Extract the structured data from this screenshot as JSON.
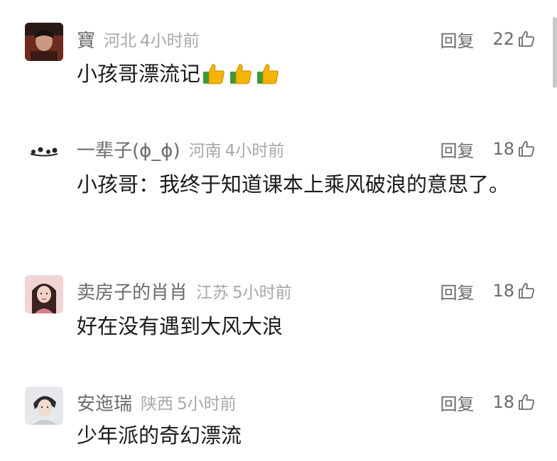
{
  "comments": [
    {
      "username": "寶",
      "location": "河北",
      "time": "4小时前",
      "reply_label": "回复",
      "likes": "22",
      "text": "小孩哥漂流记",
      "emoji": "thumbs-up",
      "emoji_count": 3
    },
    {
      "username": "一辈子(ɸ_ɸ)",
      "location": "河南",
      "time": "4小时前",
      "reply_label": "回复",
      "likes": "18",
      "text": "小孩哥：我终于知道课本上乘风破浪的意思了。"
    },
    {
      "username": "卖房子的肖肖",
      "location": "江苏",
      "time": "5小时前",
      "reply_label": "回复",
      "likes": "18",
      "text": "好在没有遇到大风大浪"
    },
    {
      "username": "安迤瑞",
      "location": "陕西",
      "time": "5小时前",
      "reply_label": "回复",
      "likes": "18",
      "text": "少年派的奇幻漂流"
    }
  ],
  "icons": {
    "like": "thumbs-up-outline-icon",
    "emoji": "thumbs-up-emoji-icon"
  },
  "colors": {
    "username": "#6b6b6b",
    "meta": "#a8a8a8",
    "body": "#1a1a1a",
    "background": "#ffffff"
  }
}
